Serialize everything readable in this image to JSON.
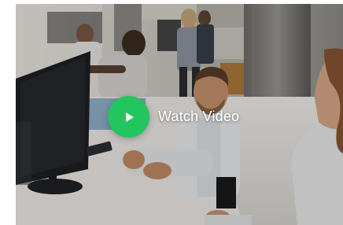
{
  "video": {
    "cta_label": "Watch Video",
    "play_icon": "play-icon",
    "accent_color": "#22c55e"
  }
}
